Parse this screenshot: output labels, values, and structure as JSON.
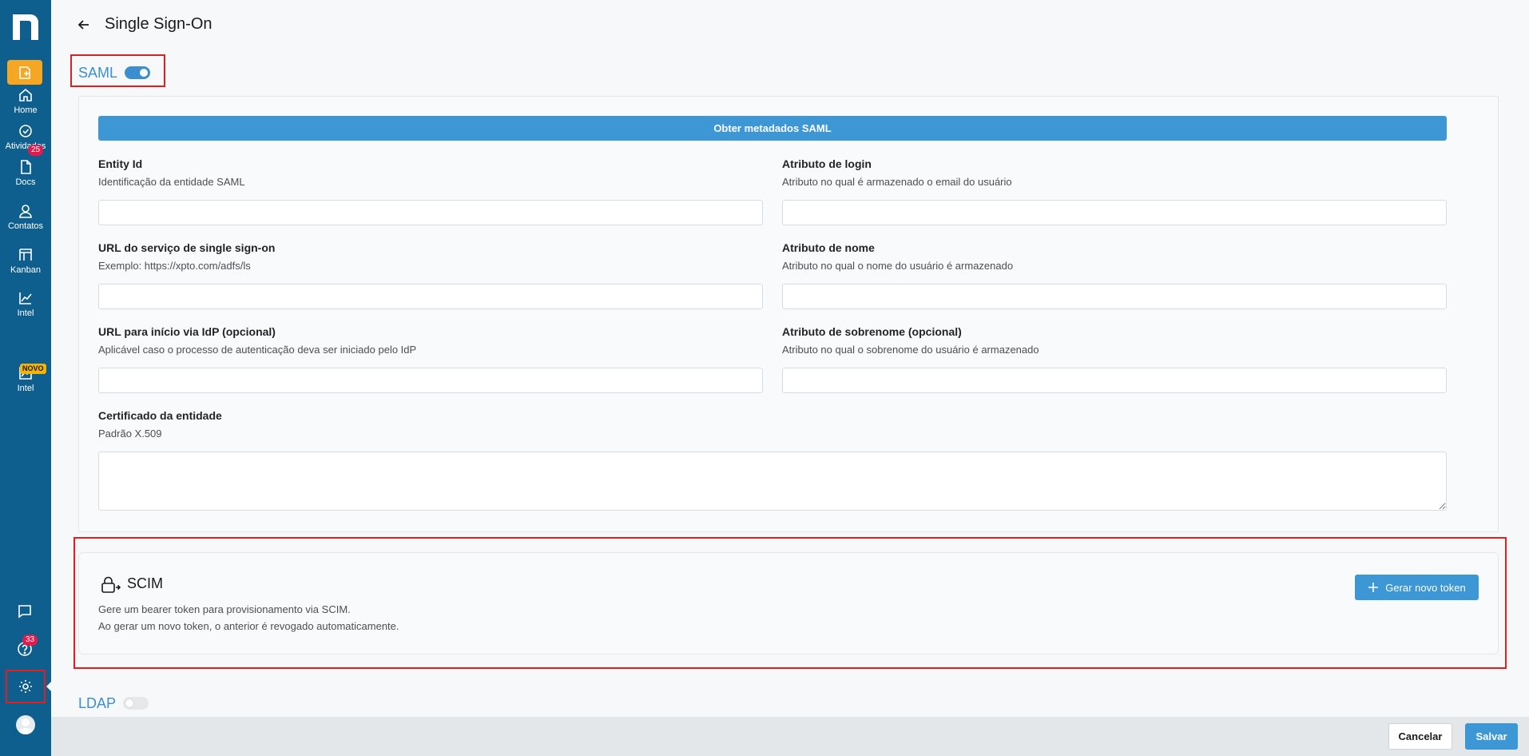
{
  "sidebar": {
    "items": [
      {
        "label": "Home",
        "icon": "home-icon"
      },
      {
        "label": "Atividades",
        "icon": "check-circle-icon",
        "badge": "25"
      },
      {
        "label": "Docs",
        "icon": "document-icon"
      },
      {
        "label": "Contatos",
        "icon": "user-icon"
      },
      {
        "label": "Kanban",
        "icon": "kanban-icon"
      },
      {
        "label": "Intel",
        "icon": "chart-line-icon"
      },
      {
        "label": "Intel",
        "icon": "chart-new-icon",
        "badge": "NOVO"
      }
    ],
    "help_badge": "33"
  },
  "header": {
    "title": "Single Sign-On"
  },
  "saml": {
    "title": "SAML",
    "enabled": true,
    "metadata_button": "Obter metadados SAML",
    "fields": {
      "entity_id": {
        "label": "Entity Id",
        "help": "Identificação da entidade SAML",
        "value": ""
      },
      "login_attr": {
        "label": "Atributo de login",
        "help": "Atributo no qual é armazenado o email do usuário",
        "value": ""
      },
      "sso_url": {
        "label": "URL do serviço de single sign-on",
        "help": "Exemplo: https://xpto.com/adfs/ls",
        "value": ""
      },
      "name_attr": {
        "label": "Atributo de nome",
        "help": "Atributo no qual o nome do usuário é armazenado",
        "value": ""
      },
      "idp_url": {
        "label": "URL para início via IdP (opcional)",
        "help": "Aplicável caso o processo de autenticação deva ser iniciado pelo IdP",
        "value": ""
      },
      "surname_attr": {
        "label": "Atributo de sobrenome (opcional)",
        "help": "Atributo no qual o sobrenome do usuário é armazenado",
        "value": ""
      },
      "certificate": {
        "label": "Certificado da entidade",
        "help": "Padrão X.509",
        "value": ""
      }
    }
  },
  "scim": {
    "title": "SCIM",
    "line1": "Gere um bearer token para provisionamento via SCIM.",
    "line2": "Ao gerar um novo token, o anterior é revogado automaticamente.",
    "button": "Gerar novo token"
  },
  "ldap": {
    "title": "LDAP",
    "enabled": false
  },
  "footer": {
    "cancel": "Cancelar",
    "save": "Salvar"
  },
  "colors": {
    "sidebar": "#0e5f8e",
    "accent": "#3d97d4",
    "highlight": "#e02020",
    "new_button": "#f5a623"
  }
}
